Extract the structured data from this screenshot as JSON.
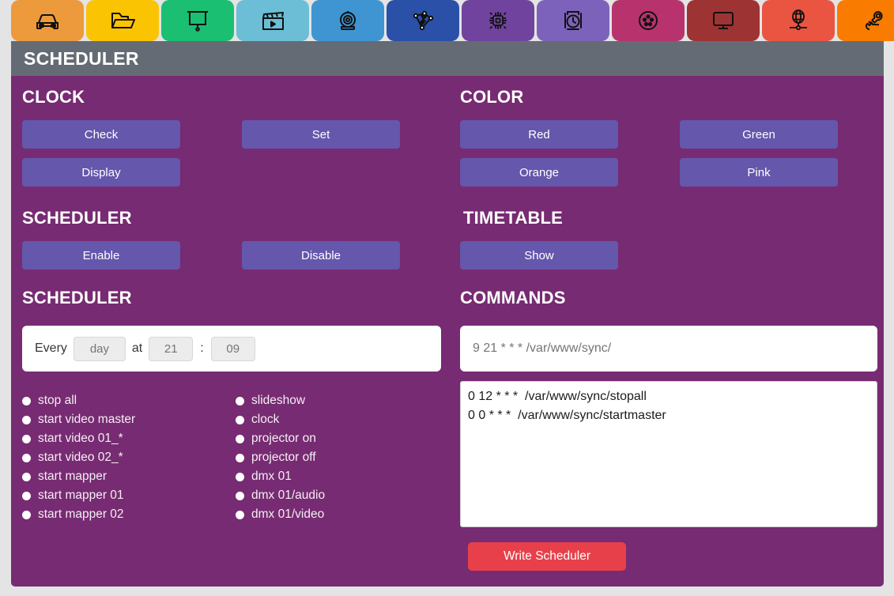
{
  "toolbar": {
    "items": [
      {
        "name": "car-icon",
        "icon": "car",
        "color": "#ed9a3d"
      },
      {
        "name": "folder-icon",
        "icon": "folder",
        "color": "#fbc403"
      },
      {
        "name": "projector-screen-icon",
        "icon": "screen",
        "color": "#1bbf72"
      },
      {
        "name": "clapperboard-icon",
        "icon": "clapper",
        "color": "#6bbed5"
      },
      {
        "name": "webcam-icon",
        "icon": "webcam",
        "color": "#3e95d2"
      },
      {
        "name": "mapping-icon",
        "icon": "mapping",
        "color": "#2a50a8"
      },
      {
        "name": "microchip-icon",
        "icon": "chip",
        "color": "#70439e"
      },
      {
        "name": "timer-icon",
        "icon": "timer",
        "color": "#7d62bb"
      },
      {
        "name": "dmx-connector-icon",
        "icon": "dmx",
        "color": "#b8336e"
      },
      {
        "name": "monitor-icon",
        "icon": "monitor",
        "color": "#9e3333"
      },
      {
        "name": "network-icon",
        "icon": "network",
        "color": "#ea5541"
      },
      {
        "name": "tools-icon",
        "icon": "tools",
        "color": "#f97b00"
      }
    ]
  },
  "window": {
    "title": "SCHEDULER",
    "panel_color": "#772b72",
    "titlebar_color": "#656b75",
    "button_color": "#6457ac",
    "accent_color": "#e8404a"
  },
  "clock": {
    "heading": "CLOCK",
    "check_label": "Check",
    "set_label": "Set",
    "display_label": "Display"
  },
  "color": {
    "heading": "COLOR",
    "red_label": "Red",
    "green_label": "Green",
    "orange_label": "Orange",
    "pink_label": "Pink"
  },
  "scheduler_toggle": {
    "heading": "SCHEDULER",
    "enable_label": "Enable",
    "disable_label": "Disable"
  },
  "timetable": {
    "heading": "TIMETABLE",
    "show_label": "Show"
  },
  "scheduler_form": {
    "heading": "SCHEDULER",
    "every_label": "Every",
    "at_label": "at",
    "colon": ":",
    "day_value": "day",
    "day_placeholder": "day",
    "hour_value": "21",
    "hour_placeholder": "21",
    "minute_value": "09",
    "minute_placeholder": "09",
    "options_col1": [
      "stop all",
      "start video master",
      "start video 01_*",
      "start video 02_*",
      "start mapper",
      "start mapper 01",
      "start mapper 02"
    ],
    "options_col2": [
      "slideshow",
      "clock",
      "projector on",
      "projector off",
      "dmx 01",
      "dmx 01/audio",
      "dmx 01/video"
    ]
  },
  "commands": {
    "heading": "COMMANDS",
    "input_value": "9 21 * * * /var/www/sync/",
    "input_placeholder": "9 21 * * * /var/www/sync/",
    "list_value": "0 12 * * *  /var/www/sync/stopall\n0 0 * * *  /var/www/sync/startmaster",
    "write_label": "Write Scheduler"
  }
}
